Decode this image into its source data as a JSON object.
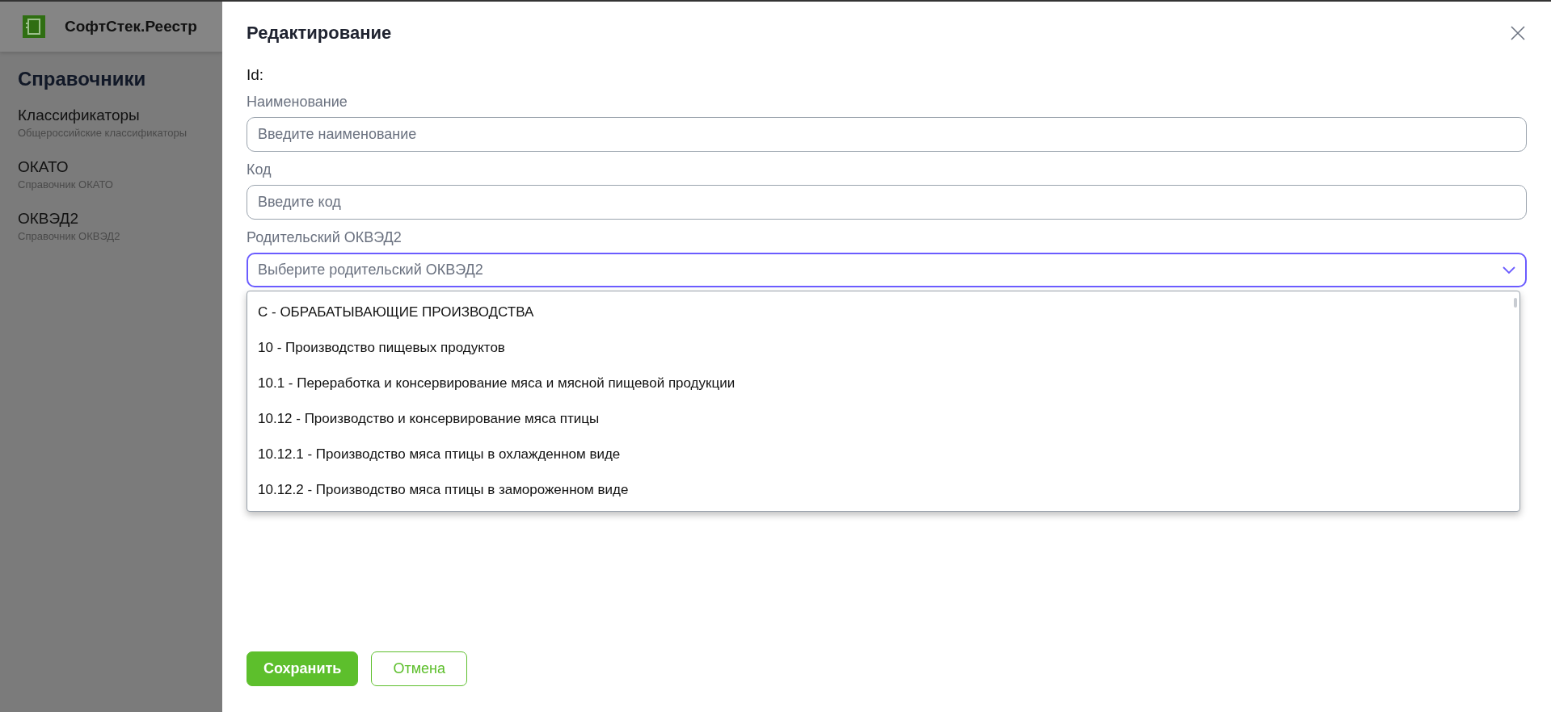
{
  "app": {
    "title": "СофтСтек.Реестр"
  },
  "sidebar": {
    "heading": "Справочники",
    "items": [
      {
        "title": "Классификаторы",
        "subtitle": "Общероссийские классификаторы"
      },
      {
        "title": "ОКАТО",
        "subtitle": "Справочник ОКАТО"
      },
      {
        "title": "ОКВЭД2",
        "subtitle": "Справочник ОКВЭД2"
      }
    ]
  },
  "dialog": {
    "title": "Редактирование",
    "id_label": "Id:",
    "fields": [
      {
        "kind": "input",
        "label": "Наименование",
        "placeholder": "Введите наименование"
      },
      {
        "kind": "input",
        "label": "Код",
        "placeholder": "Введите код"
      },
      {
        "kind": "select",
        "label": "Родительский ОКВЭД2",
        "placeholder": "Выберите родительский ОКВЭД2",
        "expanded": true,
        "options": [
          "C - ОБРАБАТЫВАЮЩИЕ ПРОИЗВОДСТВА",
          "10 - Производство пищевых продуктов",
          "10.1 - Переработка и консервирование мяса и мясной пищевой продукции",
          "10.12 - Производство и консервирование мяса птицы",
          "10.12.1 - Производство мяса птицы в охлажденном виде",
          "10.12.2 - Производство мяса птицы в замороженном виде"
        ]
      }
    ],
    "buttons": [
      {
        "kind": "primary",
        "label": "Сохранить"
      },
      {
        "kind": "secondary",
        "label": "Отмена"
      }
    ]
  }
}
